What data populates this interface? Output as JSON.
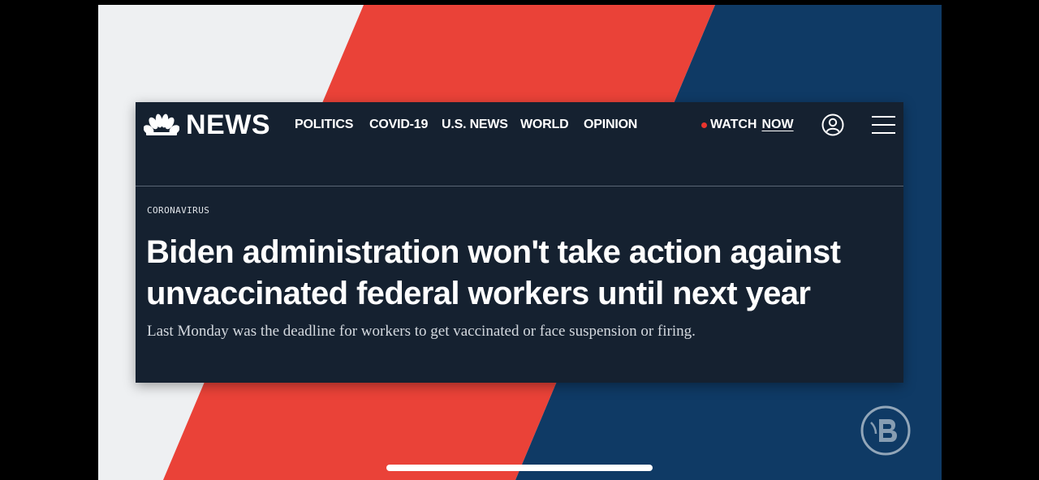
{
  "colors": {
    "stripe_white": "#eef0f2",
    "stripe_red": "#ea4238",
    "stripe_blue": "#0f3a65",
    "card_bg": "#152130",
    "live_dot": "#e8342d"
  },
  "logo": {
    "text": "NEWS",
    "icon": "nbc-peacock-icon"
  },
  "nav": {
    "items": [
      "POLITICS",
      "COVID-19",
      "U.S. NEWS",
      "WORLD",
      "OPINION"
    ]
  },
  "watch": {
    "label": "WATCH",
    "now": "NOW"
  },
  "icons": {
    "account": "user-circle-icon",
    "menu": "hamburger-menu-icon",
    "watermark": "channel-watermark-icon"
  },
  "article": {
    "eyebrow": "CORONAVIRUS",
    "headline_line1": "Biden administration won't take action against",
    "headline_line2": "unvaccinated federal workers until next year",
    "dek": "Last Monday was the deadline for workers to get vaccinated or face suspension or firing."
  }
}
